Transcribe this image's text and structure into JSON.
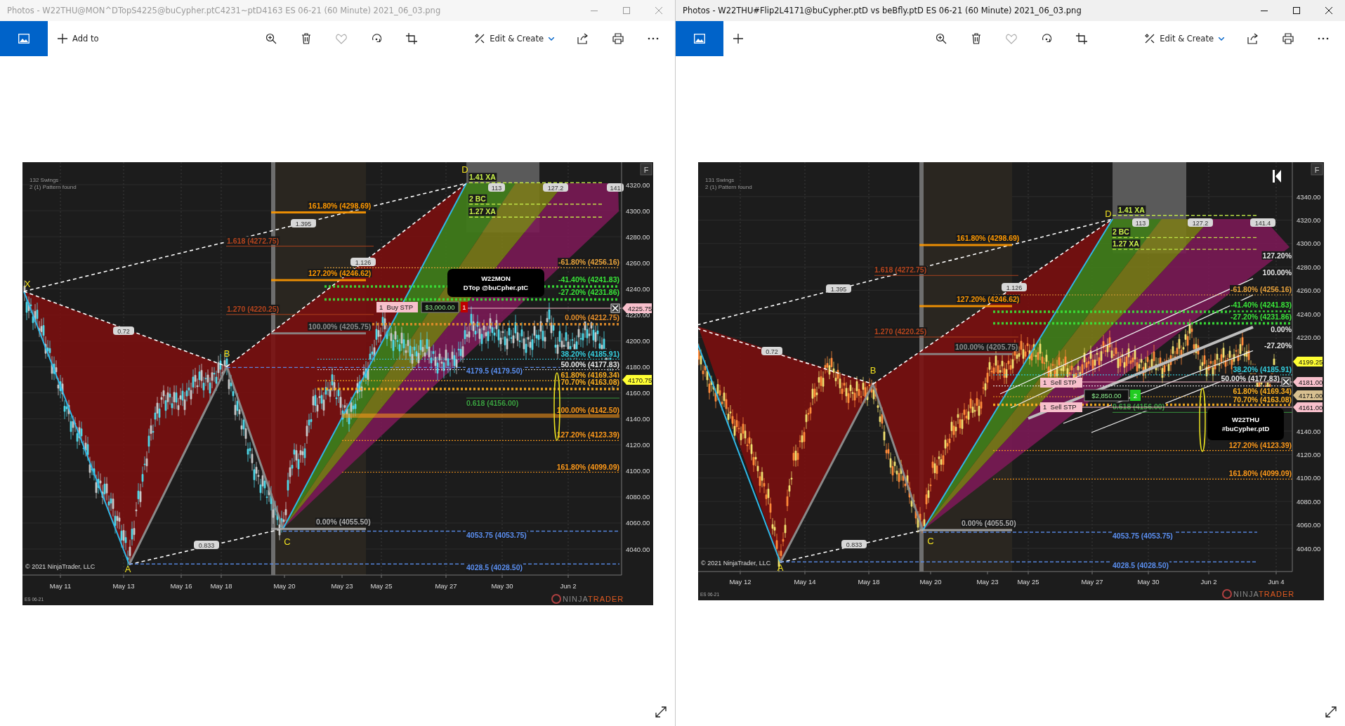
{
  "windows": [
    {
      "title": "Photos - W22THU@MON^DTopS4225@buCypher.ptC4231~ptD4163 ES 06-21 (60 Minute) 2021_06_03.png",
      "active": false,
      "add_label": "Add to",
      "edit_label": "Edit & Create",
      "chart": {
        "info": [
          "132 Swings",
          "2 (1) Pattern found"
        ],
        "corner_button": "F",
        "price_ticks": [
          "4320.00",
          "4300.00",
          "4280.00",
          "4260.00",
          "4240.00",
          "4220.00",
          "4200.00",
          "4180.00",
          "4160.00",
          "4140.00",
          "4120.00",
          "4100.00",
          "4080.00",
          "4060.00",
          "4040.00"
        ],
        "date_ticks": [
          "May 11",
          "May 13",
          "May 16",
          "May 18",
          "May 20",
          "May 23",
          "May 25",
          "May 27",
          "May 30",
          "Jun 2"
        ],
        "points": [
          "X",
          "A",
          "B",
          "C",
          "D"
        ],
        "ratios": [
          "1.395",
          "0.72",
          "1.126",
          "0.833",
          "113",
          "127.2",
          "141"
        ],
        "levels": [
          "161.80% (4298.69)",
          "1.618 (4272.75)",
          "127.20% (4246.62)",
          "1.270 (4220.25)",
          "100.00% (4205.75)",
          "1.41 XA",
          "2 BC",
          "1.27 XA",
          "-61.80% (4256.16)",
          "-41.40% (4241.83)",
          "-27.20% (4231.86)",
          "0.00% (4212.75)",
          "38.20% (4185.91)",
          "50.00% (4177.83)",
          "4179.5 (4179.50)",
          "61.80% (4169.34)",
          "70.70% (4163.08)",
          "0.618 (4156.00)",
          "100.00% (4142.50)",
          "127.20% (4123.39)",
          "161.80% (4099.09)",
          "0.00% (4055.50)",
          "4053.75 (4053.75)",
          "4028.5 (4028.50)"
        ],
        "orders": [
          "1  Buy STP"
        ],
        "position": {
          "amount": "$3,000.00",
          "count": "1",
          "color": "#c00000"
        },
        "note": [
          "W22MON",
          "DTop @buCpher.ptC"
        ],
        "flags": [
          {
            "price": "4225.75",
            "color": "#f8c0cc"
          },
          {
            "price": "4170.75",
            "color": "#ffff33"
          }
        ],
        "copyright": "© 2021 NinjaTrader, LLC",
        "instrument": "ES 06-21",
        "logo": [
          "NINJA",
          "TRADER"
        ]
      }
    },
    {
      "title": "Photos - W22THU#Flip2L4171@buCypher.ptD vs beBfly.ptD ES 06-21 (60 Minute) 2021_06_03.png",
      "active": true,
      "edit_label": "Edit & Create",
      "chart": {
        "info": [
          "131 Swings",
          "2 (1) Pattern found"
        ],
        "corner_button": "F",
        "price_ticks": [
          "4340.00",
          "4320.00",
          "4300.00",
          "4280.00",
          "4260.00",
          "4240.00",
          "4220.00",
          "4140.00",
          "4120.00",
          "4100.00",
          "4080.00",
          "4060.00",
          "4040.00"
        ],
        "date_ticks": [
          "May 12",
          "May 14",
          "May 18",
          "May 20",
          "May 23",
          "May 25",
          "May 27",
          "May 30",
          "Jun 2",
          "Jun 4"
        ],
        "points": [
          "A",
          "B",
          "C",
          "D"
        ],
        "ratios": [
          "1.395",
          "0.72",
          "1.126",
          "0.833",
          "113",
          "127.2",
          "141.4"
        ],
        "levels": [
          "161.80% (4298.69)",
          "1.618 (4272.75)",
          "127.20% (4246.62)",
          "1.270 (4220.25)",
          "100.00% (4205.75)",
          "1.41 XA",
          "2 BC",
          "1.27 XA",
          "127.20%",
          "100.00%",
          "-61.80% (4256.16)",
          "-41.40% (4241.83)",
          "-27.20% (4231.86)",
          "0.00%",
          "-27.20%",
          "38.20% (4185.91)",
          "50.00% (4177.83)",
          "61.80% (4169.34)",
          "70.70% (4163.08)",
          "0.618 (4156.00)",
          "127.20% (4123.39)",
          "161.80% (4099.09)",
          "0.00% (4055.50)",
          "4053.75 (4053.75)",
          "4028.5 (4028.50)"
        ],
        "orders": [
          "1  Sell STP",
          "1  Sell STP"
        ],
        "position": {
          "amount": "$2,850.00",
          "count": "2",
          "color": "#22cc22"
        },
        "note": [
          "W22THU",
          "#buCypher.ptD"
        ],
        "flags": [
          {
            "price": "4199.25",
            "color": "#ffff33"
          },
          {
            "price": "4181.00",
            "color": "#f8c0cc"
          },
          {
            "price": "4171.00",
            "color": "#d8c090"
          },
          {
            "price": "4161.00",
            "color": "#f8c0cc"
          }
        ],
        "copyright": "© 2021 NinjaTrader, LLC",
        "instrument": "ES 06-21",
        "logo": [
          "NINJA",
          "TRADER"
        ]
      }
    }
  ]
}
